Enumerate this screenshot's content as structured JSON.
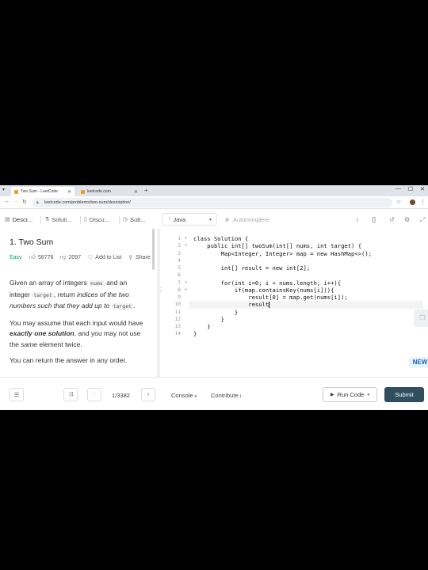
{
  "browser": {
    "tabs": [
      {
        "title": "Two Sum - LeetCode",
        "favicon_color": "#f0a020"
      },
      {
        "title": "leetcode.com",
        "favicon_color": "#f0a020"
      }
    ],
    "new_tab_icon": "plus-icon",
    "url": "leetcode.com/problems/two-sum/description/"
  },
  "lc_tabs": [
    {
      "label": "Descr...",
      "icon": "document-icon"
    },
    {
      "label": "Soluti...",
      "icon": "flask-icon"
    },
    {
      "label": "Discu...",
      "icon": "book-icon"
    },
    {
      "label": "Sub...",
      "icon": "history-icon"
    }
  ],
  "editor_header": {
    "language": "Java",
    "autocomplete_label": "Autocomplete"
  },
  "problem": {
    "title": "1. Two Sum",
    "difficulty": "Easy",
    "likes": "58778",
    "dislikes": "2097",
    "add_to_list": "Add to List",
    "share": "Share",
    "paragraph1": {
      "t1": "Given an array of integers ",
      "c1": "nums",
      "t2": " and an integer ",
      "c2": "target",
      "t3": ", return ",
      "e1": "indices of the two numbers such that they add up to",
      "c3": "target",
      "t4": "."
    },
    "paragraph2": {
      "t1": "You may assume that each input would have ",
      "b1": "exactly one solution",
      "t2": ", and you may not use the ",
      "e1": "same",
      "t3": " element twice."
    },
    "paragraph3": "You can return the answer in any order."
  },
  "code": {
    "line_numbers": [
      "1",
      "2",
      "3",
      "4",
      "5",
      "6",
      "7",
      "8",
      "9",
      "10",
      "11",
      "12",
      "13",
      "14"
    ],
    "lines": [
      "class Solution {",
      "    public int[] twoSum(int[] nums, int target) {",
      "        Map<Integer, Integer> map = new HashMap<>();",
      "",
      "        int[] result = new int[2];",
      "",
      "        for(int i=0; i < nums.length; i++){",
      "            if(map.containsKey(nums[i])){",
      "                result[0] = map.get(nums[i]);",
      "                result",
      "            }",
      "        }",
      "    }",
      "}"
    ],
    "active_line": 10
  },
  "side_badge": "NEW",
  "bottom": {
    "page_counter": "1/3382",
    "console_label": "Console",
    "contribute_label": "Contribute",
    "run_label": "Run Code",
    "submit_label": "Submit"
  }
}
